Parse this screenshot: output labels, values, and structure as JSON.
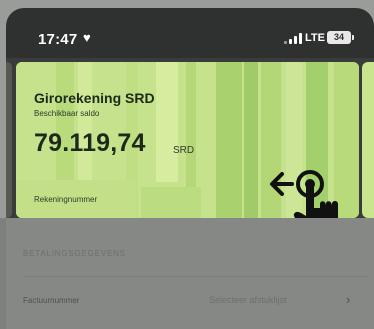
{
  "status_bar": {
    "time": "17:47",
    "heart_icon": "heart-icon",
    "network": "LTE",
    "battery": "34"
  },
  "card": {
    "account_name": "Girorekening SRD",
    "balance_label": "Beschikbaar saldo",
    "balance": "79.119,74",
    "currency": "SRD",
    "account_number_label": "Rekeningnummer",
    "accent_color": "#c9e58d"
  },
  "details": {
    "section_title": "BETALINGSGEGEVENS",
    "row": {
      "label": "Factuurnummer",
      "value": "Selecteer afstuklijst"
    }
  }
}
